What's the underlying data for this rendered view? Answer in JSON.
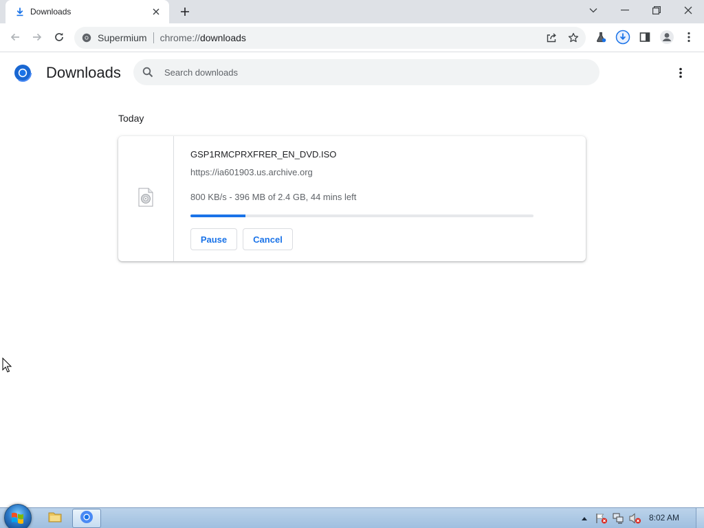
{
  "browser": {
    "tab": {
      "title": "Downloads",
      "favicon": "download-icon",
      "close": "close-icon"
    },
    "new_tab": "plus-icon",
    "window_controls": [
      "chevron-down-icon",
      "minimize-icon",
      "restore-icon",
      "close-icon"
    ],
    "nav": [
      "back-arrow-icon",
      "forward-arrow-icon",
      "reload-icon"
    ],
    "omnibox": {
      "site_chip": "Supermium",
      "url_scheme": "chrome://",
      "url_path": "downloads",
      "actions": [
        "share-icon",
        "star-icon"
      ]
    },
    "toolbar_actions": [
      "extensions-flask-icon",
      "downloads-icon",
      "side-panel-icon",
      "profile-avatar-icon",
      "menu-kebab-icon"
    ]
  },
  "page": {
    "title": "Downloads",
    "search": {
      "placeholder": "Search downloads",
      "value": ""
    },
    "menu_icon": "more-vertical-icon"
  },
  "downloads": {
    "section_label": "Today",
    "items": [
      {
        "file_name": "GSP1RMCPRXFRER_EN_DVD.ISO",
        "source_url": "https://ia601903.us.archive.org",
        "status": "800 KB/s - 396 MB of 2.4 GB, 44 mins left",
        "progress_fraction": 0.16,
        "file_icon": "disc-file-icon",
        "actions": {
          "pause": "Pause",
          "cancel": "Cancel"
        }
      }
    ]
  },
  "taskbar": {
    "start": "windows-start-icon",
    "apps": [
      "file-explorer-icon",
      "browser-icon"
    ],
    "tray": [
      "show-hidden-icons-chevron",
      "action-center-flag-icon",
      "network-icon",
      "volume-muted-icon"
    ],
    "clock": "8:02 AM"
  },
  "colors": {
    "accent": "#1a73e8",
    "tabstrip": "#dee1e6",
    "omnibox": "#f1f3f4",
    "text_primary": "#202124",
    "text_secondary": "#5f6368"
  }
}
